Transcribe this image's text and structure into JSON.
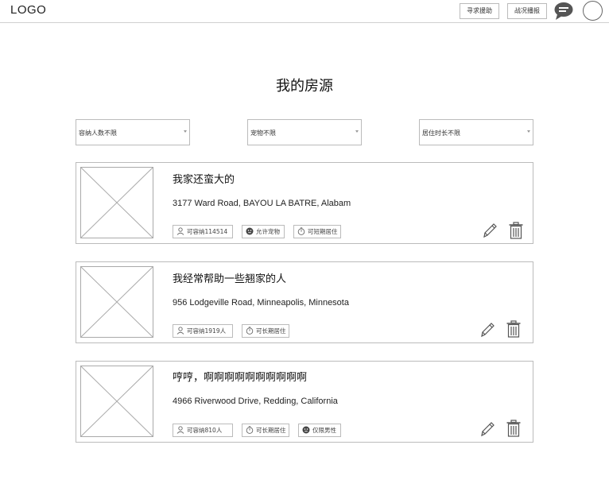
{
  "header": {
    "logo": "LOGO",
    "buttons": [
      {
        "label": "寻求援助"
      },
      {
        "label": "战况播报"
      }
    ],
    "icons": {
      "message": "message-icon",
      "avatar": "avatar"
    }
  },
  "page": {
    "title": "我的房源"
  },
  "filters": [
    {
      "label": "容纳人数不限"
    },
    {
      "label": "宠物不限"
    },
    {
      "label": "居住时长不限"
    }
  ],
  "listings": [
    {
      "title": "我家还蛮大的",
      "address": "3177 Ward Road, BAYOU LA BATRE, Alabam",
      "tags": [
        {
          "icon": "person-icon",
          "label": "可容纳114514"
        },
        {
          "icon": "pet-icon",
          "label": "允许宠物"
        },
        {
          "icon": "timer-icon",
          "label": "可短期居住"
        }
      ]
    },
    {
      "title": "我经常帮助一些翘家的人",
      "address": "956 Lodgeville Road, Minneapolis, Minnesota",
      "tags": [
        {
          "icon": "person-icon",
          "label": "可容纳1919人"
        },
        {
          "icon": "timer-icon",
          "label": "可长期居住"
        }
      ]
    },
    {
      "title": "哼哼，啊啊啊啊啊啊啊啊啊啊",
      "address": "4966 Riverwood Drive, Redding, California",
      "tags": [
        {
          "icon": "person-icon",
          "label": "可容纳810人"
        },
        {
          "icon": "timer-icon",
          "label": "可长期居住"
        },
        {
          "icon": "pet-icon",
          "label": "仅限男性"
        }
      ]
    }
  ]
}
